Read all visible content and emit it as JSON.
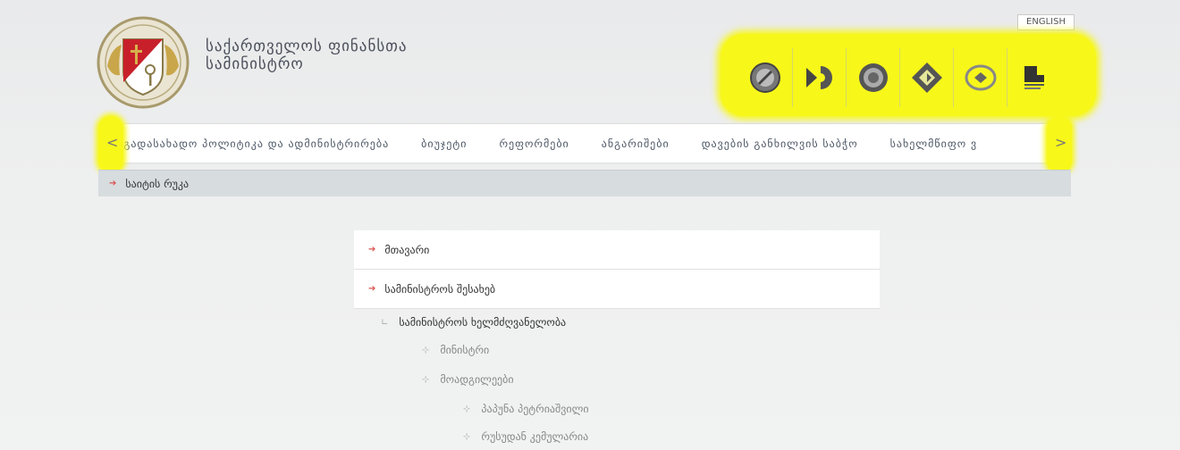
{
  "header": {
    "title_line1": "საქართველოს ფინანსთა",
    "title_line2": "სამინისტრო",
    "english_label": "ENGLISH",
    "partner_icons": [
      "revenue-service-icon",
      "treasury-icon",
      "investigation-service-icon",
      "state-procurement-icon",
      "financial-police-icon",
      "academy-icon"
    ],
    "highlight_color": "#f7f71a"
  },
  "nav": {
    "items": [
      "საგადასახადო პოლიტიკა და ადმინისტრირება",
      "ბიუჯეტი",
      "რეფორმები",
      "ანგარიშები",
      "დავების განხილვის საბჭო",
      "სახელმწიფო ვ"
    ],
    "prev_arrow": "<",
    "next_arrow": ">"
  },
  "breadcrumb": {
    "label": "საიტის რუკა"
  },
  "sitemap": {
    "top_items": [
      "მთავარი",
      "სამინისტროს შესახებ"
    ],
    "level1": "სამინისტროს ხელმძღვანელობა",
    "level2": [
      "მინისტრი",
      "მოადგილეები"
    ],
    "level3": [
      "პაპუნა პეტრიაშვილი",
      "რუსუდან კემულარია"
    ]
  }
}
